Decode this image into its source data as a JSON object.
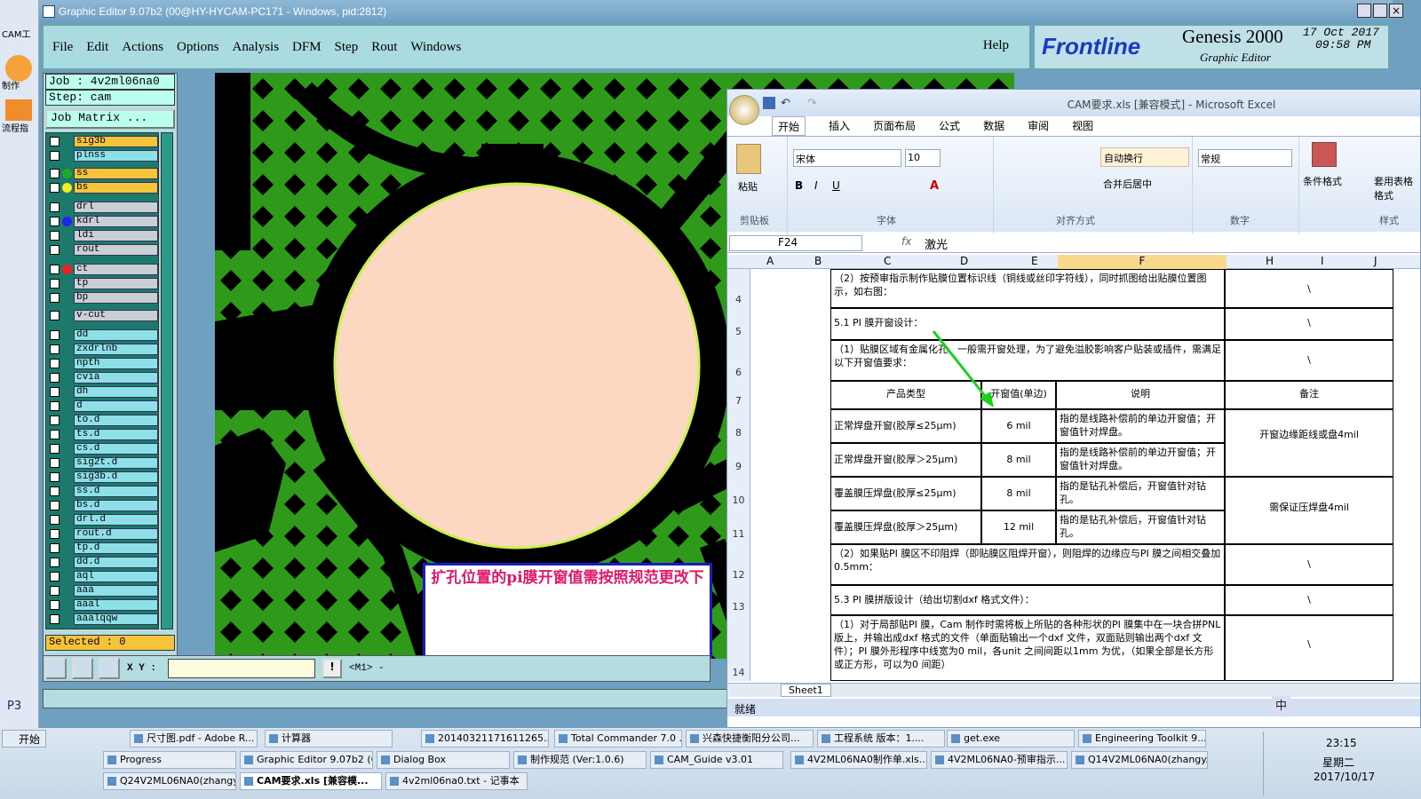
{
  "left_strip": {
    "label": "CAM工",
    "items": [
      "制作",
      "流程指"
    ],
    "bottom": "P3"
  },
  "ge": {
    "title": "Graphic Editor 9.07b2 (00@HY-HYCAM-PC171 - Windows, pid:2812)",
    "menus": [
      "File",
      "Edit",
      "Actions",
      "Options",
      "Analysis",
      "DFM",
      "Step",
      "Rout",
      "Windows"
    ],
    "help": "Help",
    "brand": {
      "logo": "Frontline",
      "product": "Genesis 2000",
      "sub": "Graphic Editor",
      "date": "17 Oct 2017",
      "time": "09:58 PM"
    },
    "job": "Job : 4v2ml06na0",
    "step": "Step: cam",
    "matrix": "Job Matrix ...",
    "layers": [
      "sig3b",
      "plnss",
      "ss",
      "bs",
      "drl",
      "kdrl",
      "ldi",
      "rout",
      "ct",
      "tp",
      "bp",
      "v-cut",
      "dd",
      "zxdrlnb",
      "npth",
      "cvia",
      "dh",
      "d",
      "to.d",
      "ts.d",
      "cs.d",
      "sig2t.d",
      "sig3b.d",
      "ss.d",
      "bs.d",
      "drl.d",
      "rout.d",
      "tp.d",
      "dd.d",
      "aql",
      "aaa",
      "aaal",
      "aaalqqw"
    ],
    "selected": "Selected : 0",
    "xy_label": "X Y :",
    "m1": "<M1> -",
    "annotation": "扩孔位置的pi膜开窗值需按照规范更改下"
  },
  "excel": {
    "title": "CAM要求.xls [兼容模式] - Microsoft Excel",
    "tabs": [
      "开始",
      "插入",
      "页面布局",
      "公式",
      "数据",
      "审阅",
      "视图"
    ],
    "font": "宋体",
    "size": "10",
    "numfmt": "常规",
    "groups": [
      "剪贴板",
      "字体",
      "对齐方式",
      "数字",
      "样式"
    ],
    "paste": "粘贴",
    "wrap": "自动换行",
    "merge": "合并后居中",
    "cond": "条件格式",
    "table": "套用表格格式",
    "cellref": "F24",
    "formula": "激光",
    "cols": [
      "A",
      "B",
      "C",
      "D",
      "E",
      "F",
      "H",
      "I",
      "J"
    ],
    "rows": [
      "4",
      "5",
      "6",
      "7",
      "8",
      "9",
      "10",
      "11",
      "12",
      "13",
      "14"
    ],
    "r4": "（2）按预审指示制作贴膜位置标识线（铜线或丝印字符线），同时抓图给出贴膜位置图示，如右图：",
    "r5": "5.1 PI 膜开窗设计：",
    "r6": "（1）贴膜区域有金属化孔，一般需开窗处理，为了避免溢胶影响客户贴装或插件，需满足以下开窗值要求：",
    "hdr": [
      "产品类型",
      "开窗值(单边)",
      "说明",
      "备注"
    ],
    "r8": [
      "正常焊盘开窗(胶厚≤25μm)",
      "6 mil",
      "指的是线路补偿前的单边开窗值；开窗值针对焊盘。"
    ],
    "r9": [
      "正常焊盘开窗(胶厚＞25μm)",
      "8 mil",
      "指的是线路补偿前的单边开窗值；开窗值针对焊盘。"
    ],
    "r10": [
      "覆盖膜压焊盘(胶厚≤25μm)",
      "8 mil",
      "指的是钻孔补偿后，开窗值针对钻孔。"
    ],
    "r11": [
      "覆盖膜压焊盘(胶厚＞25μm)",
      "12 mil",
      "指的是钻孔补偿后，开窗值针对钻孔。"
    ],
    "note89": "开窗边缘距线或盘4mil",
    "note1011": "需保证压焊盘4mil",
    "r12": "（2）如果贴PI 膜区不印阻焊（即贴膜区阻焊开窗），则阻焊的边缘应与PI 膜之间相交叠加0.5mm：",
    "r13": "5.3 PI 膜拼版设计（给出切割dxf 格式文件）：",
    "r14": "（1）对于局部贴PI 膜，Cam 制作时需将板上所贴的各种形状的PI 膜集中在一块合拼PNL 版上，并输出成dxf 格式的文件（单面贴输出一个dxf 文件，双面贴则输出两个dxf 文件）；PI 膜外形程序中线宽为0 mil，各unit 之间间距以1mm 为优，（如果全部是长方形或正方形，可以为0 间距）",
    "slash": "\\",
    "sheet": "Sheet1",
    "status": "就绪"
  },
  "taskbar": {
    "start": "开始",
    "row1": [
      "尺寸图.pdf - Adobe R...",
      "计算器",
      "20140321171611265....",
      "Total Commander 7.0 ...",
      "兴森快捷衡阳分公司...",
      "工程系统  版本：1....",
      "get.exe",
      "Engineering Toolkit 9...."
    ],
    "row2": [
      "Progress",
      "Graphic Editor 9.07b2 (0...",
      "Dialog Box",
      "制作规范 (Ver:1.0.6)",
      "CAM_Guide v3.01",
      "4V2ML06NA0制作单.xls...",
      "4V2ML06NA0-预审指示...",
      "Q14V2ML06NA0(zhangy..."
    ],
    "row3": [
      "Q24V2ML06NA0(zhangy...",
      "CAM要求.xls [兼容模...",
      "4v2ml06na0.txt - 记事本"
    ],
    "ime": "中",
    "clock": "23:15",
    "weekday": "星期二",
    "date": "2017/10/17"
  }
}
